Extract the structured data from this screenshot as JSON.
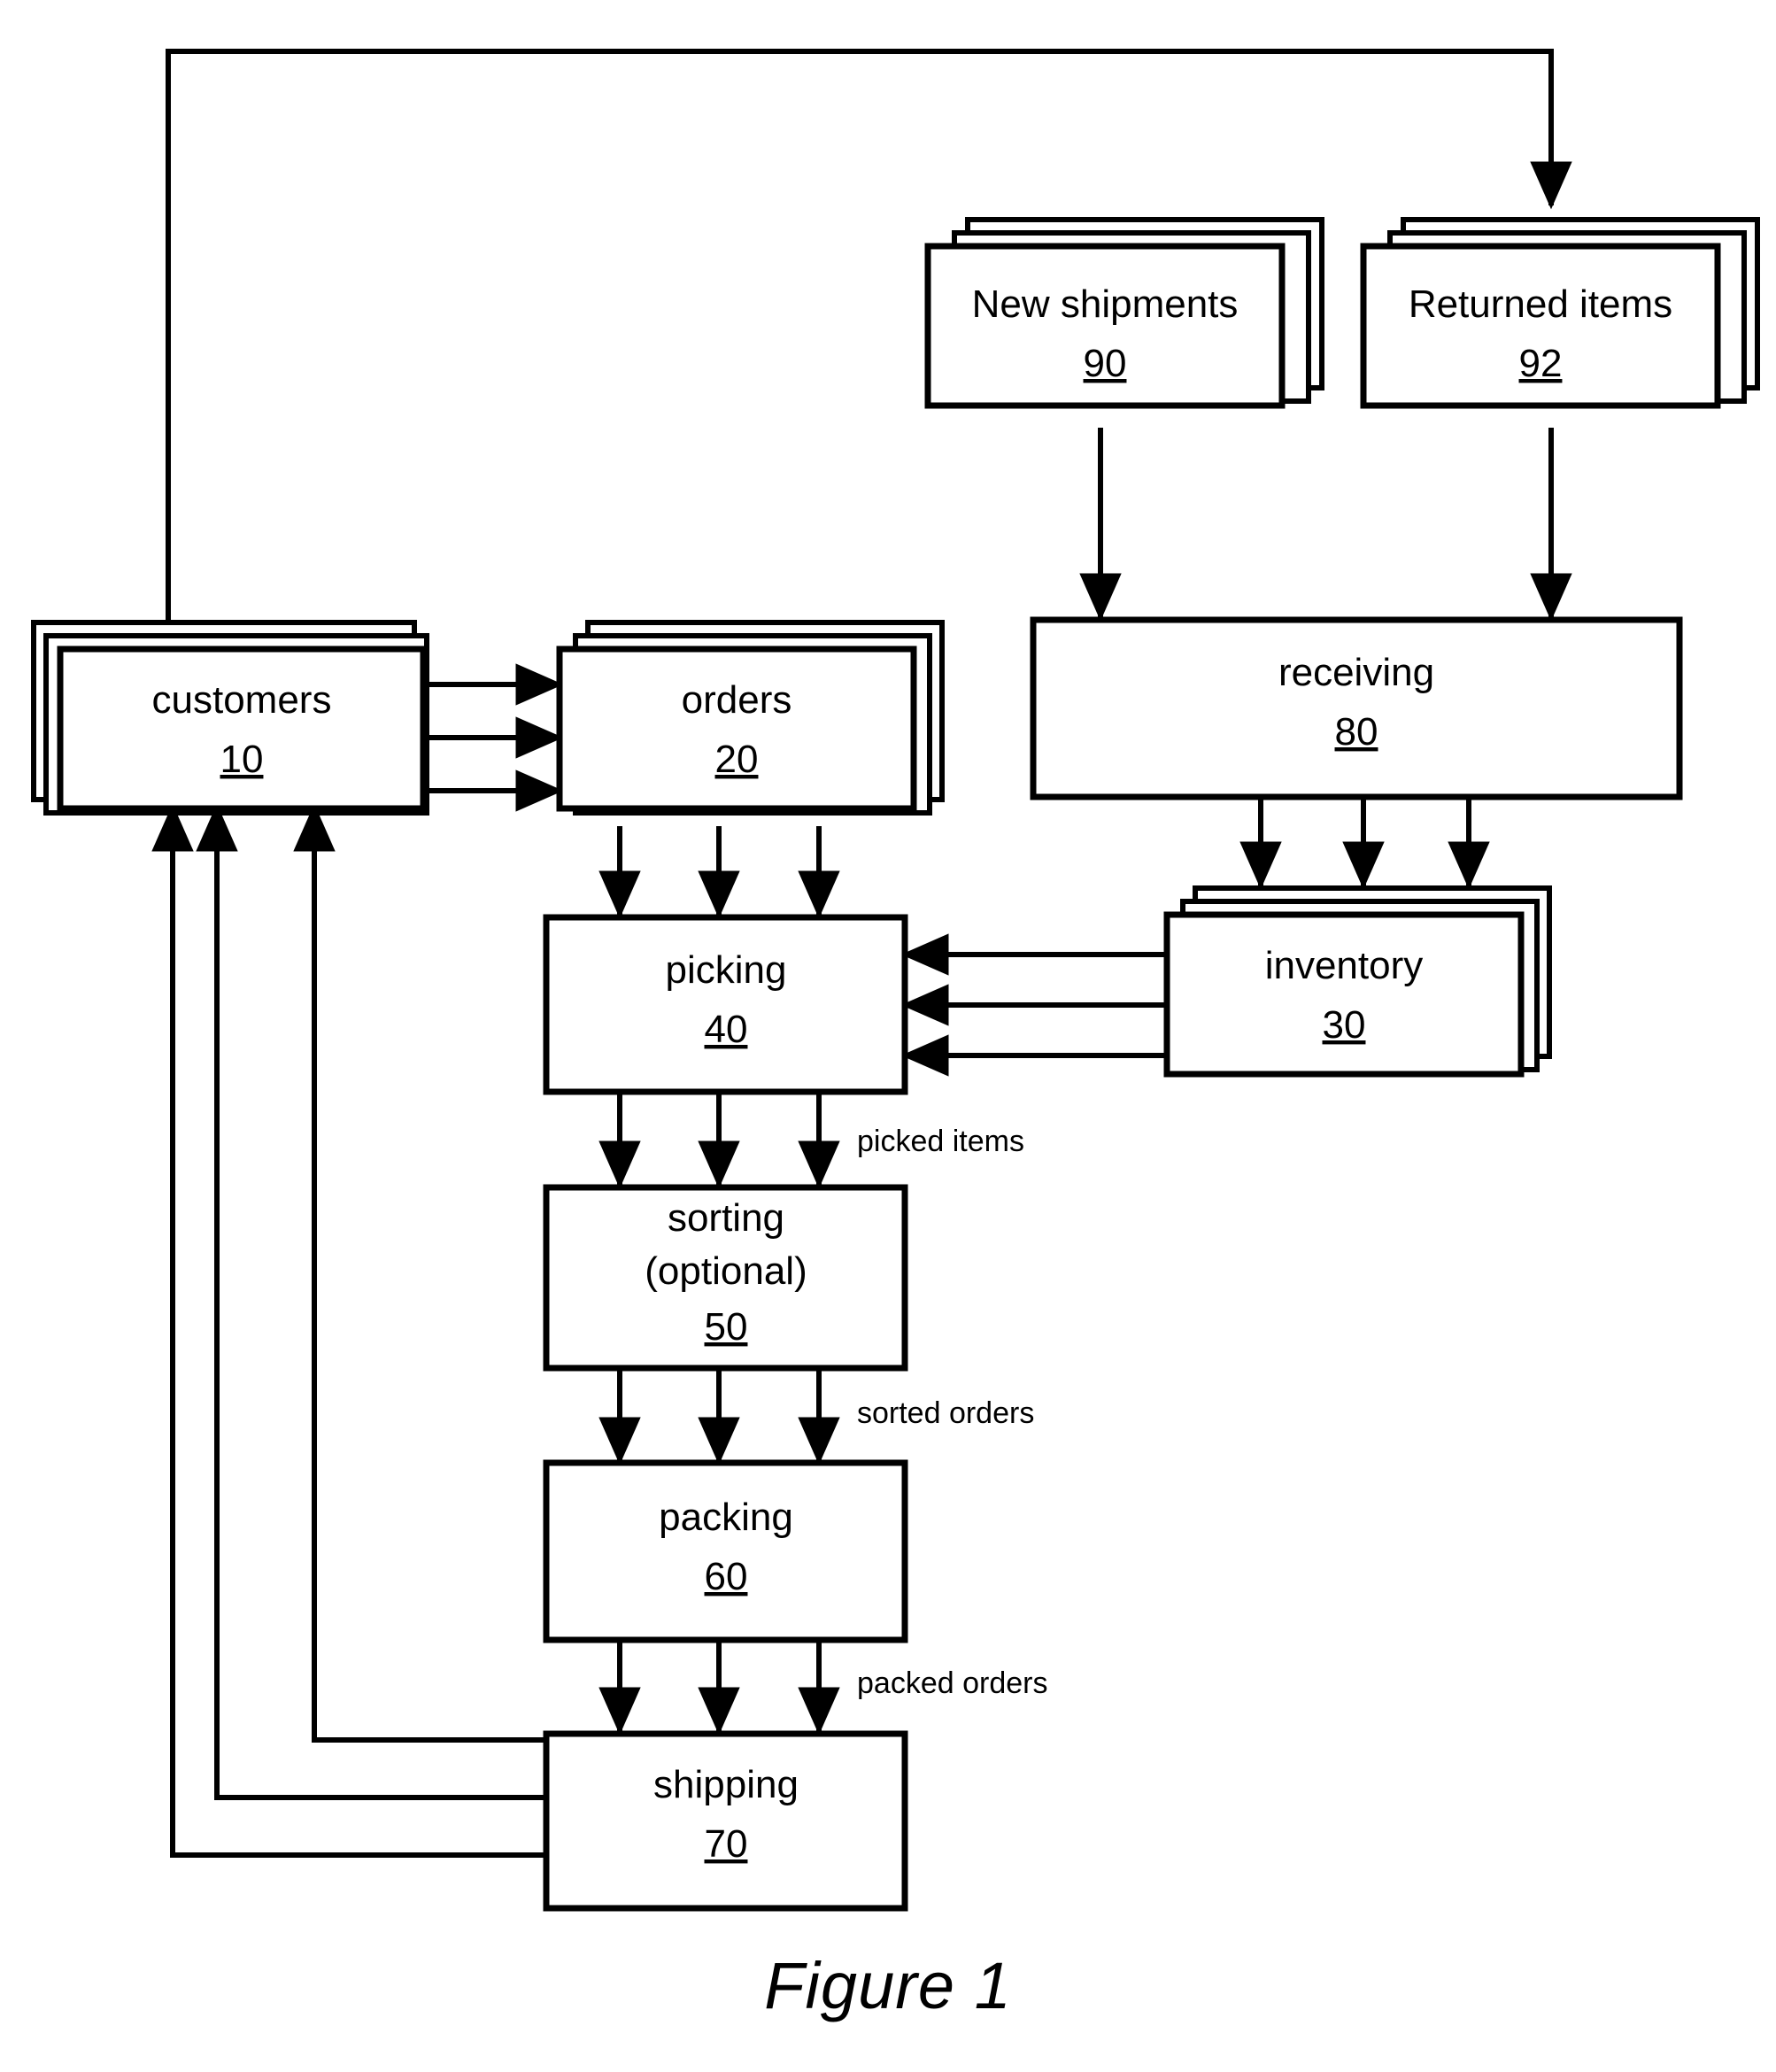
{
  "figure": {
    "caption": "Figure 1",
    "type": "patent-flow-diagram"
  },
  "nodes": [
    {
      "id": "customers",
      "label": "customers",
      "ref": "10",
      "stacked": true,
      "stack_dir": "left"
    },
    {
      "id": "orders",
      "label": "orders",
      "ref": "20",
      "stacked": true,
      "stack_dir": "right"
    },
    {
      "id": "inventory",
      "label": "inventory",
      "ref": "30",
      "stacked": true,
      "stack_dir": "right"
    },
    {
      "id": "picking",
      "label": "picking",
      "ref": "40",
      "stacked": false,
      "stack_dir": ""
    },
    {
      "id": "sorting",
      "label": "sorting",
      "label2": "(optional)",
      "ref": "50",
      "stacked": false,
      "stack_dir": ""
    },
    {
      "id": "packing",
      "label": "packing",
      "ref": "60",
      "stacked": false,
      "stack_dir": ""
    },
    {
      "id": "shipping",
      "label": "shipping",
      "ref": "70",
      "stacked": false,
      "stack_dir": ""
    },
    {
      "id": "receiving",
      "label": "receiving",
      "ref": "80",
      "stacked": false,
      "stack_dir": ""
    },
    {
      "id": "new_shipments",
      "label": "New shipments",
      "ref": "90",
      "stacked": true,
      "stack_dir": "right"
    },
    {
      "id": "returned_items",
      "label": "Returned items",
      "ref": "92",
      "stacked": true,
      "stack_dir": "right"
    }
  ],
  "flow_labels": [
    {
      "id": "picked_items",
      "text": "picked items"
    },
    {
      "id": "sorted_orders",
      "text": "sorted orders"
    },
    {
      "id": "packed_orders",
      "text": "packed orders"
    }
  ],
  "edges": [
    {
      "from": "customers",
      "to": "orders",
      "count": 3,
      "label": ""
    },
    {
      "from": "orders",
      "to": "picking",
      "count": 3,
      "label": ""
    },
    {
      "from": "picking",
      "to": "sorting",
      "count": 3,
      "label": "picked items"
    },
    {
      "from": "sorting",
      "to": "packing",
      "count": 3,
      "label": "sorted orders"
    },
    {
      "from": "packing",
      "to": "shipping",
      "count": 3,
      "label": "packed orders"
    },
    {
      "from": "shipping",
      "to": "customers",
      "count": 3,
      "label": ""
    },
    {
      "from": "customers",
      "to": "returned_items",
      "count": 1,
      "label": ""
    },
    {
      "from": "new_shipments",
      "to": "receiving",
      "count": 1,
      "label": ""
    },
    {
      "from": "returned_items",
      "to": "receiving",
      "count": 1,
      "label": ""
    },
    {
      "from": "receiving",
      "to": "inventory",
      "count": 3,
      "label": ""
    },
    {
      "from": "inventory",
      "to": "picking",
      "count": 3,
      "label": ""
    }
  ],
  "style": {
    "line_color": "#000000",
    "fill_color": "#ffffff",
    "background": "#ffffff"
  }
}
